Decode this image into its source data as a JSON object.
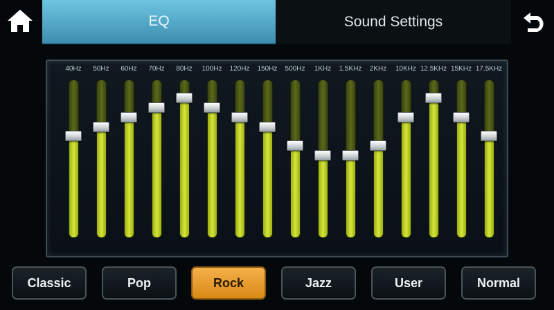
{
  "tabs": {
    "eq": "EQ",
    "sound_settings": "Sound Settings"
  },
  "eq": {
    "bands": [
      {
        "label": "40Hz",
        "level": 0.64
      },
      {
        "label": "50Hz",
        "level": 0.7
      },
      {
        "label": "60Hz",
        "level": 0.76
      },
      {
        "label": "70Hz",
        "level": 0.82
      },
      {
        "label": "80Hz",
        "level": 0.88
      },
      {
        "label": "100Hz",
        "level": 0.82
      },
      {
        "label": "120Hz",
        "level": 0.76
      },
      {
        "label": "150Hz",
        "level": 0.7
      },
      {
        "label": "500Hz",
        "level": 0.58
      },
      {
        "label": "1KHz",
        "level": 0.52
      },
      {
        "label": "1.5KHz",
        "level": 0.52
      },
      {
        "label": "2KHz",
        "level": 0.58
      },
      {
        "label": "10KHz",
        "level": 0.76
      },
      {
        "label": "12.5KHz",
        "level": 0.88
      },
      {
        "label": "15KHz",
        "level": 0.76
      },
      {
        "label": "17.5KHz",
        "level": 0.64
      }
    ]
  },
  "presets": [
    {
      "label": "Classic",
      "active": false
    },
    {
      "label": "Pop",
      "active": false
    },
    {
      "label": "Rock",
      "active": true
    },
    {
      "label": "Jazz",
      "active": false
    },
    {
      "label": "User",
      "active": false
    },
    {
      "label": "Normal",
      "active": false
    }
  ],
  "icons": {
    "home": "home-icon",
    "back": "back-arrow-icon"
  },
  "colors": {
    "active_tab": "#4fa6c8",
    "active_preset": "#e89a28",
    "slider_fill": "#c2d42a"
  }
}
